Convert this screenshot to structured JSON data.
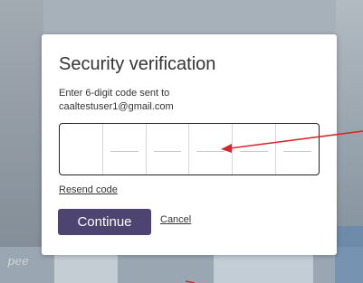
{
  "dialog": {
    "title": "Security verification",
    "instruction": "Enter 6-digit code sent to",
    "email": "caaltestuser1@gmail.com",
    "code_digits": [
      "",
      "",
      "",
      "",
      "",
      ""
    ],
    "resend_label": "Resend code",
    "continue_label": "Continue",
    "cancel_label": "Cancel"
  },
  "background": {
    "script_text": "pee"
  },
  "colors": {
    "primary_button": "#4e4472",
    "annotation_arrow": "#d7262c"
  },
  "icons": [
    "annotation-arrow-icon"
  ]
}
